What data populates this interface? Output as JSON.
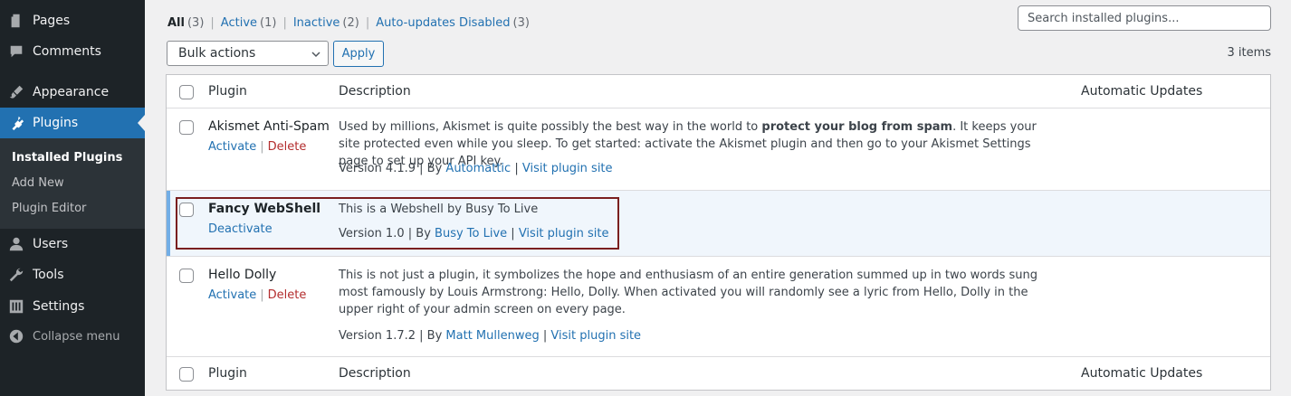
{
  "sidebar": {
    "pages": "Pages",
    "comments": "Comments",
    "appearance": "Appearance",
    "plugins": "Plugins",
    "installed": "Installed Plugins",
    "add_new": "Add New",
    "editor": "Plugin Editor",
    "users": "Users",
    "tools": "Tools",
    "settings": "Settings",
    "collapse": "Collapse menu"
  },
  "filters": {
    "all": "All",
    "all_count": "(3)",
    "active": "Active",
    "active_count": "(1)",
    "inactive": "Inactive",
    "inactive_count": "(2)",
    "auto": "Auto-updates Disabled",
    "auto_count": "(3)",
    "sep": "|"
  },
  "search": {
    "placeholder": "Search installed plugins..."
  },
  "bulk": {
    "label": "Bulk actions",
    "apply": "Apply",
    "items": "3 items"
  },
  "table": {
    "col_plugin": "Plugin",
    "col_desc": "Description",
    "col_auto": "Automatic Updates"
  },
  "plugins": [
    {
      "name": "Akismet Anti-Spam",
      "action1": "Activate",
      "action2": "Delete",
      "desc_pre": "Used by millions, Akismet is quite possibly the best way in the world to ",
      "desc_bold": "protect your blog from spam",
      "desc_post": ". It keeps your site protected even while you sleep. To get started: activate the Akismet plugin and then go to your Akismet Settings page to set up your API key.",
      "version": "Version 4.1.9",
      "by": "| By",
      "author": "Automattic",
      "site": "Visit plugin site"
    },
    {
      "name": "Fancy WebShell",
      "action1": "Deactivate",
      "desc": "This is a Webshell by Busy To Live",
      "version": "Version 1.0",
      "by": "| By",
      "author": "Busy To Live",
      "site": "Visit plugin site"
    },
    {
      "name": "Hello Dolly",
      "action1": "Activate",
      "action2": "Delete",
      "desc": "This is not just a plugin, it symbolizes the hope and enthusiasm of an entire generation summed up in two words sung most famously by Louis Armstrong: Hello, Dolly. When activated you will randomly see a lyric from Hello, Dolly in the upper right of your admin screen on every page.",
      "version": "Version 1.7.2",
      "by": "| By",
      "author": "Matt Mullenweg",
      "site": "Visit plugin site"
    }
  ],
  "colors": {
    "sidebar": "#1d2327",
    "accent": "#2271b1",
    "delete": "#b32d2e",
    "highlight": "#7a1f1f"
  }
}
